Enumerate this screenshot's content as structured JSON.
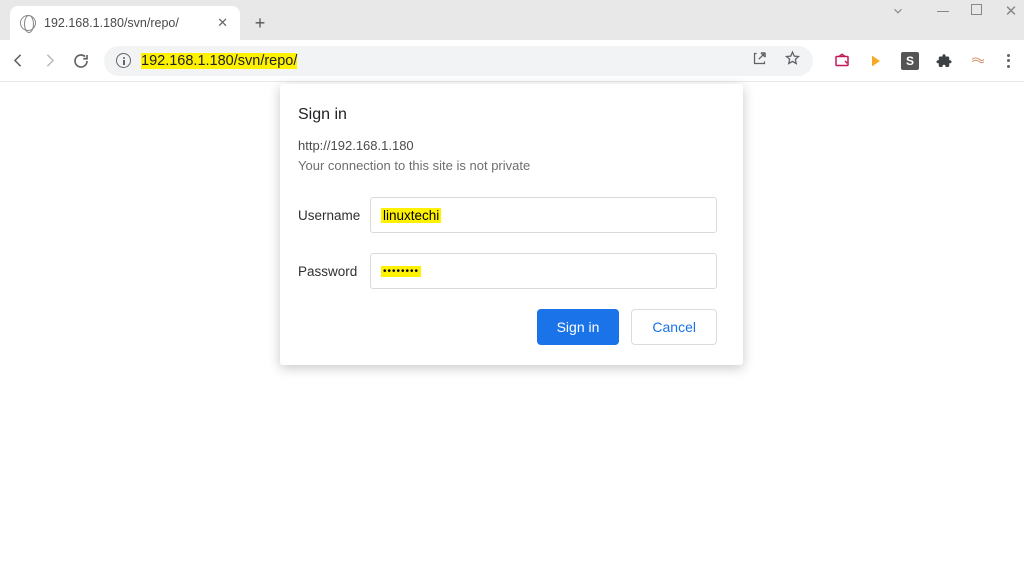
{
  "window": {
    "active_tab_title": "192.168.1.180/svn/repo/"
  },
  "address_bar": {
    "url": "192.168.1.180/svn/repo/"
  },
  "dialog": {
    "title": "Sign in",
    "origin": "http://192.168.1.180",
    "warning": "Your connection to this site is not private",
    "username_label": "Username",
    "username_value": "linuxtechi",
    "password_label": "Password",
    "password_masked": "••••••••",
    "signin": "Sign in",
    "cancel": "Cancel"
  },
  "icons": {
    "ext_badge": "S"
  }
}
